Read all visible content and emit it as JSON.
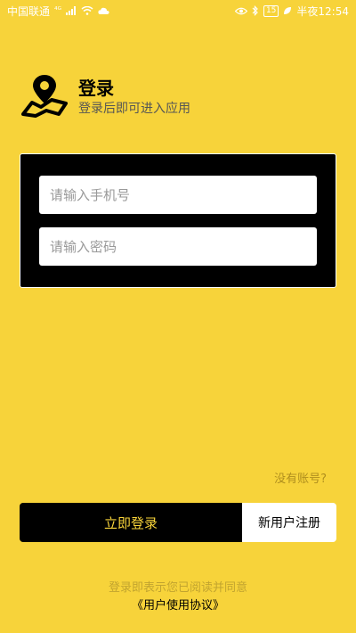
{
  "status_bar": {
    "carrier": "中国联通",
    "signal_label": "⁴ᴳ",
    "battery": "15",
    "time_label": "半夜12:54",
    "icons": [
      "signal-icon",
      "wifi-icon",
      "cloud-icon",
      "eye-icon",
      "bluetooth-icon",
      "battery-icon",
      "leaf-icon"
    ]
  },
  "header": {
    "title": "登录",
    "subtitle": "登录后即可进入应用",
    "logo_icon": "map-pin-icon"
  },
  "form": {
    "phone_placeholder": "请输入手机号",
    "password_placeholder": "请输入密码"
  },
  "no_account_label": "没有账号?",
  "buttons": {
    "login_label": "立即登录",
    "register_label": "新用户注册"
  },
  "agreement": {
    "text": "登录即表示您已阅读并同意",
    "link": "《用户使用协议》"
  },
  "colors": {
    "background": "#F7D33A",
    "accent": "#000000"
  }
}
